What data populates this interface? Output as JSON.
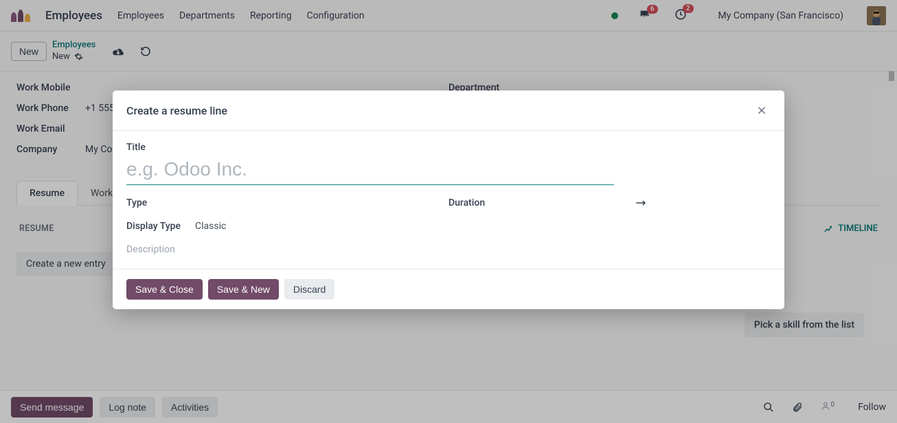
{
  "app": {
    "title": "Employees"
  },
  "nav": {
    "items": [
      "Employees",
      "Departments",
      "Reporting",
      "Configuration"
    ],
    "messages_badge": "6",
    "activities_badge": "2",
    "company": "My Company (San Francisco)"
  },
  "controlbar": {
    "new_button": "New",
    "breadcrumb_root": "Employees",
    "breadcrumb_current": "New"
  },
  "form": {
    "labels": {
      "work_mobile": "Work Mobile",
      "work_phone": "Work Phone",
      "work_email": "Work Email",
      "company": "Company",
      "department": "Department"
    },
    "values": {
      "work_phone": "+1 555",
      "company": "My Company"
    },
    "tabs": [
      "Resume",
      "Work"
    ],
    "resume_heading": "RESUME",
    "timeline_label": "TIMELINE",
    "create_entry": "Create a new entry",
    "pick_skill": "Pick a skill from the list"
  },
  "modal": {
    "title": "Create a resume line",
    "fields": {
      "title_label": "Title",
      "title_placeholder": "e.g. Odoo Inc.",
      "type_label": "Type",
      "duration_label": "Duration",
      "display_type_label": "Display Type",
      "display_type_value": "Classic",
      "description_placeholder": "Description"
    },
    "buttons": {
      "save_close": "Save & Close",
      "save_new": "Save & New",
      "discard": "Discard"
    }
  },
  "chatter": {
    "send": "Send message",
    "log": "Log note",
    "activities": "Activities",
    "follower_count": "0",
    "follow": "Follow"
  }
}
